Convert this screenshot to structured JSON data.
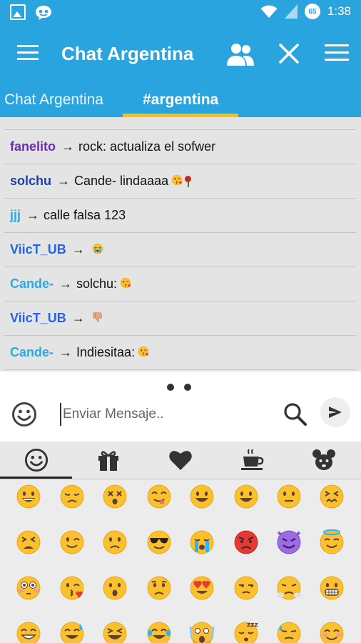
{
  "status_bar": {
    "time": "1:38",
    "badge": "65"
  },
  "app_bar": {
    "title": "Chat Argentina"
  },
  "tabs": [
    {
      "label": "Chat Argentina"
    },
    {
      "label": "#argentina"
    }
  ],
  "messages": [
    {
      "nick": "fanelito",
      "nick_color": "#6a2fb0",
      "arrow": "→",
      "text": "rock: actualiza el sofwer",
      "emojis": []
    },
    {
      "nick": "solchu",
      "nick_color": "#1e3fa8",
      "arrow": "→",
      "text": "Cande- lindaaaa",
      "emojis": [
        "kiss-face",
        "rose"
      ]
    },
    {
      "nick": "jjj",
      "nick_color": "#29a9e6",
      "arrow": "→",
      "text": "calle falsa 123",
      "emojis": []
    },
    {
      "nick": "ViicT_UB",
      "nick_color": "#2563e6",
      "arrow": "→",
      "text": "",
      "emojis": [
        "crying-face"
      ]
    },
    {
      "nick": "Cande-",
      "nick_color": "#29a9e6",
      "arrow": "→",
      "text": "solchu:",
      "emojis": [
        "kiss-face"
      ]
    },
    {
      "nick": "ViicT_UB",
      "nick_color": "#2563e6",
      "arrow": "→",
      "text": "",
      "emojis": [
        "thumbs-down"
      ]
    },
    {
      "nick": "Cande-",
      "nick_color": "#29a9e6",
      "arrow": "→",
      "text": "Indiesitaa:",
      "emojis": [
        "kiss-face"
      ]
    }
  ],
  "composer": {
    "placeholder": "Enviar Mensaje.."
  },
  "emoji_categories": [
    "smiley-icon",
    "gift-icon",
    "heart-icon",
    "coffee-icon",
    "animal-icon"
  ],
  "emoji_rows": [
    [
      "grinning",
      "disappointed",
      "dizzy",
      "yum",
      "smiley",
      "smiley",
      "neutral",
      "confounded"
    ],
    [
      "persevere",
      "wink",
      "frowning",
      "sunglasses",
      "crying",
      "angry",
      "imp",
      "innocent"
    ],
    [
      "flushed",
      "kissing-heart",
      "open-mouth",
      "worried",
      "heart-eyes",
      "unamused",
      "triumph",
      "grimacing"
    ],
    [
      "grin",
      "sweat-smile",
      "laughing",
      "joy",
      "scream",
      "sleeping",
      "sweat",
      "blush"
    ]
  ],
  "colors": {
    "primary": "#2aa4de",
    "accent": "#ffc107",
    "emoji_yellow": "#fbc02d"
  }
}
